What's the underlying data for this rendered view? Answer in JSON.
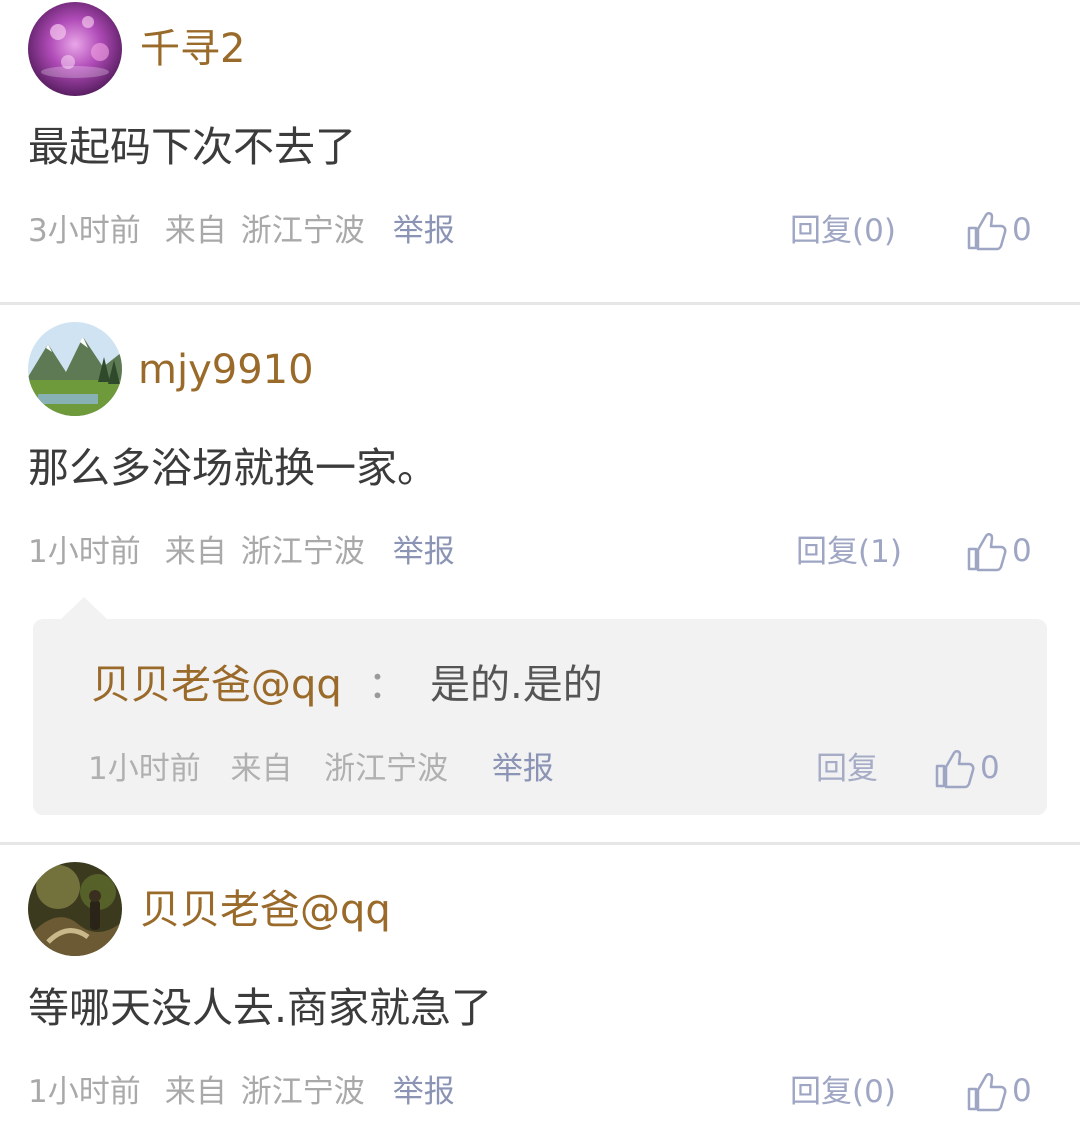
{
  "comments": [
    {
      "username": "千寻2",
      "text": "最起码下次不去了",
      "time": "3小时前",
      "from": "来自",
      "location": "浙江宁波",
      "report": "举报",
      "reply": "回复(0)",
      "likes": "0"
    },
    {
      "username": "mjy9910",
      "text": "那么多浴场就换一家。",
      "time": "1小时前",
      "from": "来自",
      "location": "浙江宁波",
      "report": "举报",
      "reply": "回复(1)",
      "likes": "0",
      "replies": [
        {
          "username": "贝贝老爸@qq",
          "colon": "：",
          "text": "是的.是的",
          "time": "1小时前",
          "from": "来自",
          "location": "浙江宁波",
          "report": "举报",
          "reply": "回复",
          "likes": "0"
        }
      ]
    },
    {
      "username": "贝贝老爸@qq",
      "text": "等哪天没人去.商家就急了",
      "time": "1小时前",
      "from": "来自",
      "location": "浙江宁波",
      "report": "举报",
      "reply": "回复(0)",
      "likes": "0"
    }
  ],
  "icons": {
    "like": "thumbs-up-icon"
  },
  "colors": {
    "username": "#9a6a2a",
    "action": "#9ea6c4",
    "meta": "#a9a9a9"
  }
}
